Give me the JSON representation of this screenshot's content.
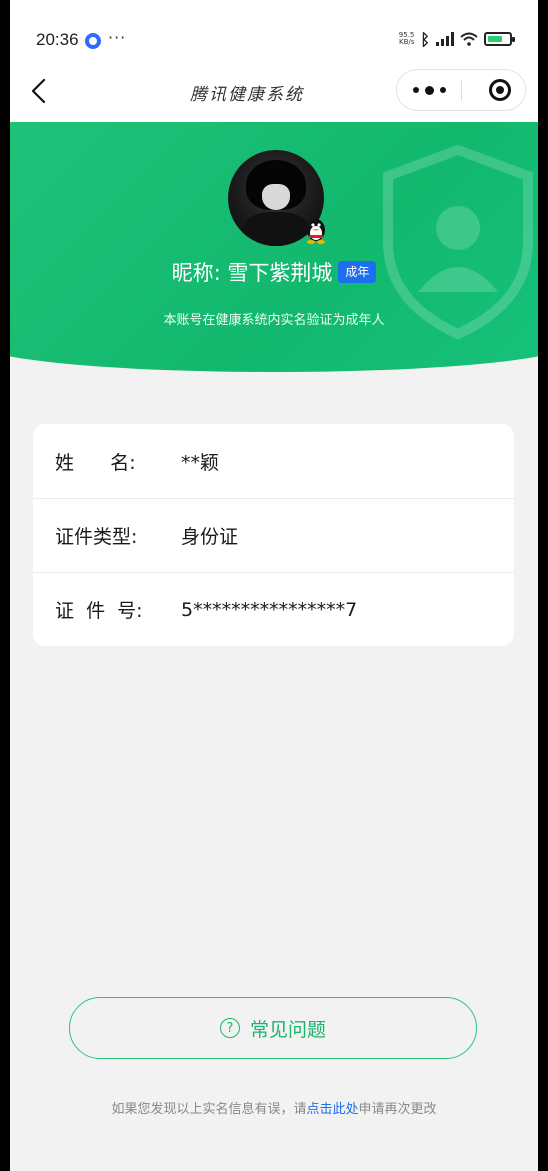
{
  "status_bar": {
    "time": "20:36",
    "more": "···",
    "net_speed": "95.5 KB/s"
  },
  "nav": {
    "title": "腾讯健康系统",
    "back_icon": "chevron-left-icon",
    "more_icon": "more-dots-icon",
    "close_icon": "target-close-icon"
  },
  "profile": {
    "nickname": "昵称: 雪下紫荆城",
    "badge": "成年",
    "subtitle": "本账号在健康系统内实名验证为成年人"
  },
  "info": {
    "rows": [
      {
        "label": "姓      名:",
        "value": "**颖"
      },
      {
        "label": "证件类型:",
        "value": "身份证"
      },
      {
        "label": "证  件  号:",
        "value": "5****************7"
      }
    ]
  },
  "faq": {
    "label": "常见问题",
    "icon": "?"
  },
  "footnote": {
    "before": "如果您发现以上实名信息有误，请",
    "link": "点击此处",
    "after": "申请再次更改"
  },
  "colors": {
    "accent_green": "#1db46b",
    "badge_blue": "#1e6ef0",
    "link_blue": "#1e6ef0"
  }
}
